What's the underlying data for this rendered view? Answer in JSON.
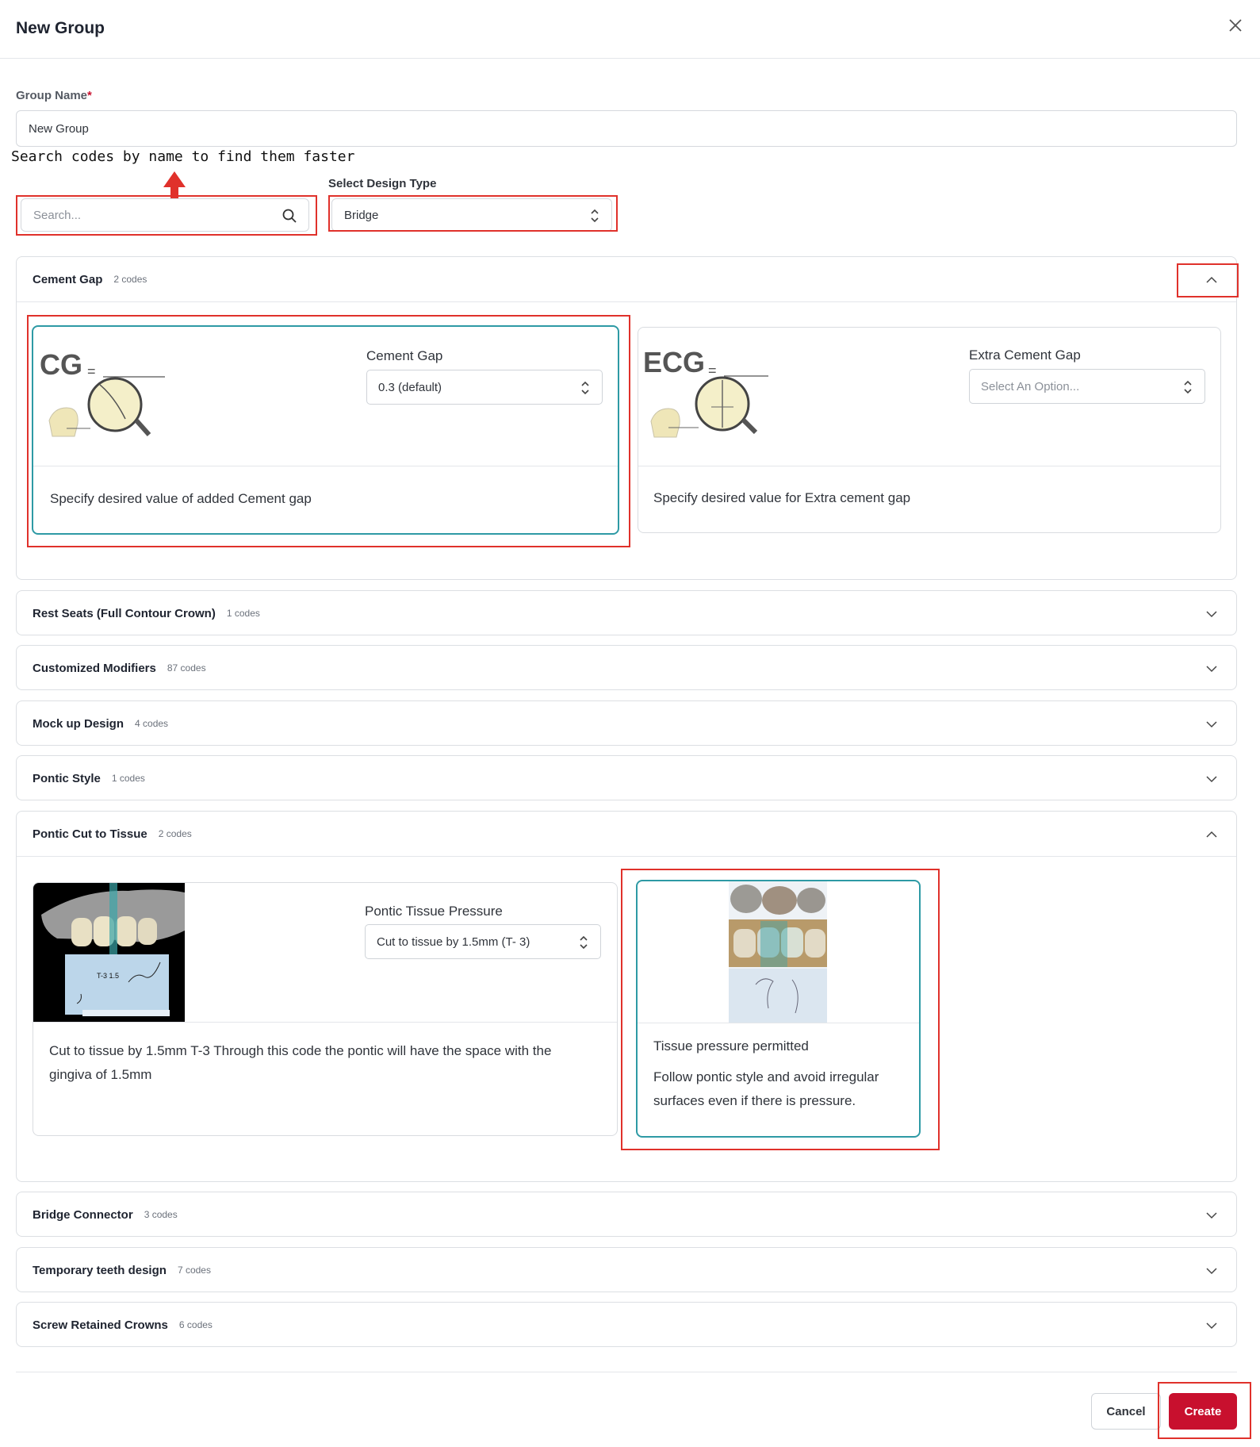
{
  "dialog": {
    "title": "New Group"
  },
  "form": {
    "group_name_label": "Group Name",
    "group_name_required": "*",
    "group_name_value": "New Group",
    "search_hint": "Search codes by name to find them faster",
    "search_placeholder": "Search...",
    "design_type_label": "Select Design Type",
    "design_type_value": "Bridge"
  },
  "sections": [
    {
      "title": "Cement Gap",
      "count": "2 codes",
      "expanded": true
    },
    {
      "title": "Rest Seats (Full Contour Crown)",
      "count": "1 codes",
      "expanded": false
    },
    {
      "title": "Customized Modifiers",
      "count": "87 codes",
      "expanded": false
    },
    {
      "title": "Mock up Design",
      "count": "4 codes",
      "expanded": false
    },
    {
      "title": "Pontic Style",
      "count": "1 codes",
      "expanded": false
    },
    {
      "title": "Pontic Cut to Tissue",
      "count": "2 codes",
      "expanded": true
    },
    {
      "title": "Bridge Connector",
      "count": "3 codes",
      "expanded": false
    },
    {
      "title": "Temporary teeth design",
      "count": "7 codes",
      "expanded": false
    },
    {
      "title": "Screw Retained Crowns",
      "count": "6 codes",
      "expanded": false
    }
  ],
  "cement_gap_cards": [
    {
      "image_text": "CG",
      "image_eq": "=",
      "label": "Cement Gap",
      "value": "0.3 (default)",
      "description": "Specify desired value of added Cement gap",
      "selected": true
    },
    {
      "image_text": "ECG",
      "image_eq": "=",
      "label": "Extra Cement Gap",
      "placeholder": "Select An Option...",
      "description": "Specify desired value for Extra cement gap",
      "selected": false
    }
  ],
  "pontic_cards": [
    {
      "label": "Pontic Tissue Pressure",
      "value": "Cut to tissue by 1.5mm (T- 3)",
      "image_caption": "T-3 1.5",
      "description": "Cut to tissue by 1.5mm T-3 Through this code the pontic will have the space with the gingiva of 1.5mm",
      "selected": false
    },
    {
      "title": "Tissue pressure permitted",
      "description": "Follow pontic style and avoid irregular surfaces even if there is pressure.",
      "selected": true
    }
  ],
  "footer": {
    "cancel_label": "Cancel",
    "create_label": "Create"
  },
  "colors": {
    "accent": "#c8102e",
    "selected_border": "#2e9aa5",
    "annotation": "#e0312b"
  }
}
